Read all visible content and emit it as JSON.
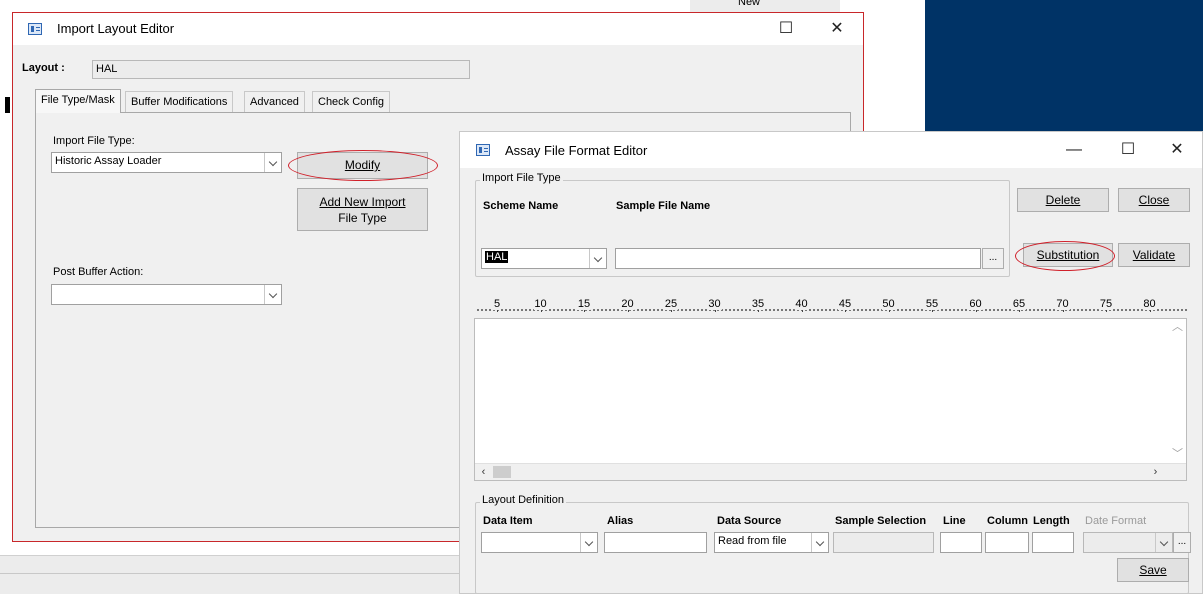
{
  "background": {
    "new_label": "New"
  },
  "import_layout_editor": {
    "title": "Import Layout Editor",
    "layout_label": "Layout :",
    "layout_value": "HAL",
    "tabs": [
      {
        "label": "File Type/Mask"
      },
      {
        "label": "Buffer Modifications"
      },
      {
        "label": "Advanced"
      },
      {
        "label": "Check Config"
      }
    ],
    "import_file_type_label": "Import File Type:",
    "import_file_type_value": "Historic Assay Loader",
    "modify_label": "Modify",
    "add_new_line1": "Add New Import",
    "add_new_line2": "File Type",
    "post_buffer_label": "Post Buffer Action:",
    "post_buffer_value": ""
  },
  "assay_editor": {
    "title": "Assay File Format Editor",
    "import_group_title": "Import File Type",
    "scheme_name_label": "Scheme Name",
    "scheme_name_value": "HAL",
    "sample_file_label": "Sample File Name",
    "sample_file_value": "",
    "browse_label": "...",
    "delete_label": "Delete",
    "close_label": "Close",
    "substitution_label": "Substitution",
    "validate_label": "Validate",
    "ruler": [
      "5",
      "10",
      "15",
      "20",
      "25",
      "30",
      "35",
      "40",
      "45",
      "50",
      "55",
      "60",
      "65",
      "70",
      "75",
      "80"
    ],
    "layout_group_title": "Layout Definition",
    "col_data_item": "Data Item",
    "col_alias": "Alias",
    "col_data_source": "Data Source",
    "col_sample_selection": "Sample Selection",
    "col_line": "Line",
    "col_column": "Column",
    "col_length": "Length",
    "col_date_format": "Date Format",
    "data_source_value": "Read from file",
    "save_label": "Save"
  },
  "colors": {
    "highlight_ellipse": "#d0202a",
    "window_border": "#c8272a",
    "background_panel": "#003366"
  }
}
